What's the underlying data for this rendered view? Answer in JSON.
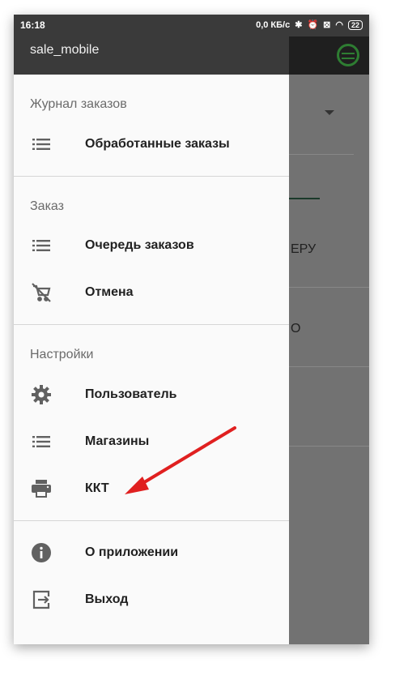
{
  "status_bar": {
    "time": "16:18",
    "network_speed": "0,0 КБ/с",
    "battery": "22"
  },
  "drawer": {
    "header_title": "sale_mobile",
    "sections": [
      {
        "title": "Журнал заказов",
        "items": [
          {
            "label": "Обработанные заказы",
            "icon": "list-icon"
          }
        ]
      },
      {
        "title": "Заказ",
        "items": [
          {
            "label": "Очередь заказов",
            "icon": "list-icon"
          },
          {
            "label": "Отмена",
            "icon": "cart-off-icon"
          }
        ]
      },
      {
        "title": "Настройки",
        "items": [
          {
            "label": "Пользователь",
            "icon": "gear-icon"
          },
          {
            "label": "Магазины",
            "icon": "list-icon"
          },
          {
            "label": "ККТ",
            "icon": "printer-icon"
          }
        ]
      },
      {
        "title": "",
        "items": [
          {
            "label": "О приложении",
            "icon": "info-icon"
          },
          {
            "label": "Выход",
            "icon": "exit-icon"
          }
        ]
      }
    ]
  },
  "background": {
    "text1": "ЕРУ",
    "text2": "О"
  },
  "colors": {
    "annotation_arrow": "#e02020",
    "brand_green": "#2e7d32"
  }
}
